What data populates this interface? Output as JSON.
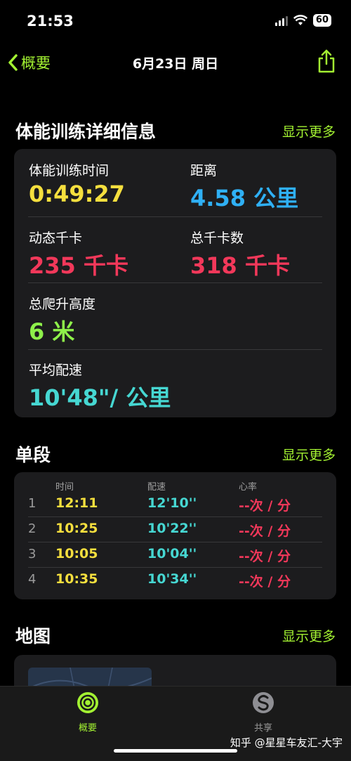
{
  "status_bar": {
    "time": "21:53",
    "battery": "60"
  },
  "nav": {
    "back_label": "概要",
    "title": "6月23日 周日"
  },
  "details": {
    "title": "体能训练详细信息",
    "more": "显示更多",
    "duration_label": "体能训练时间",
    "duration_value": "0:49:27",
    "distance_label": "距离",
    "distance_value": "4.58 公里",
    "active_label": "动态千卡",
    "active_value": "235 千卡",
    "total_label": "总千卡数",
    "total_value": "318 千卡",
    "climb_label": "总爬升高度",
    "climb_value": "6 米",
    "pace_label": "平均配速",
    "pace_value": "10'48\"/ 公里"
  },
  "splits": {
    "title": "单段",
    "more": "显示更多",
    "headers": {
      "time": "时间",
      "pace": "配速",
      "hr": "心率"
    },
    "rows": [
      {
        "index": "1",
        "time": "12:11",
        "pace": "12'10''",
        "hr": "--次 / 分"
      },
      {
        "index": "2",
        "time": "10:25",
        "pace": "10'22''",
        "hr": "--次 / 分"
      },
      {
        "index": "3",
        "time": "10:05",
        "pace": "10'04''",
        "hr": "--次 / 分"
      },
      {
        "index": "4",
        "time": "10:35",
        "pace": "10'34''",
        "hr": "--次 / 分"
      }
    ]
  },
  "map": {
    "title": "地图",
    "more": "显示更多"
  },
  "tabs": {
    "summary": "概要",
    "sharing": "共享"
  },
  "watermark": "知乎 @星星车友汇-大宇",
  "colors": {
    "accent": "#a3f232",
    "yellow": "#f5df3e",
    "blue": "#2fb0f5",
    "red": "#f2385a",
    "green": "#8ef04a",
    "teal": "#46d7d2"
  }
}
